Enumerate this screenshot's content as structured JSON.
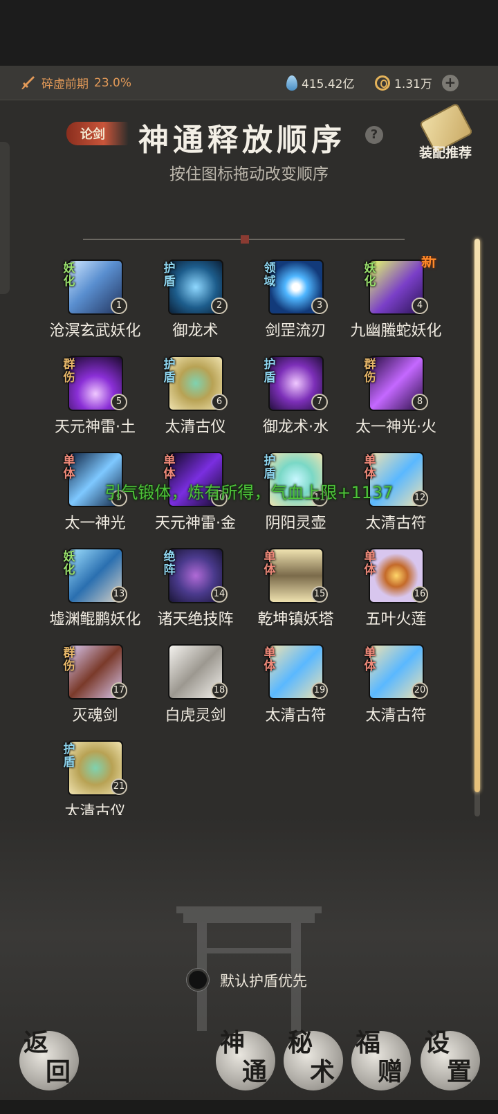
{
  "status": {
    "realm_label": "碎虚前期",
    "realm_percent": "23.0%",
    "spirit_stones": "415.42亿",
    "coins": "1.31万"
  },
  "header": {
    "badge": "论剑",
    "title": "神通释放顺序",
    "help": "?",
    "recommend": "装配推荐",
    "subtitle": "按住图标拖动改变顺序"
  },
  "skills": [
    {
      "num": "1",
      "name": "沧溟玄武妖化",
      "tag": "妖化",
      "tag_type": "yao",
      "art": "linear-gradient(135deg,#cfe6ff,#5a8fd0 45%,#22345e)"
    },
    {
      "num": "2",
      "name": "御龙术",
      "tag": "护盾",
      "tag_type": "shield",
      "art": "radial-gradient(circle,#8fd8ff,#1d5d8c 55%,#0c1f36)"
    },
    {
      "num": "3",
      "name": "剑罡流刃",
      "tag": "领域",
      "tag_type": "domain",
      "art": "radial-gradient(circle,#ffffff 10%,#4fb6ff 30%,#123a7a 70%)"
    },
    {
      "num": "4",
      "name": "九幽螣蛇妖化",
      "tag": "妖化",
      "tag_type": "yao",
      "art": "linear-gradient(135deg,#e6ff6a,#7a3fc8 55%,#2b1454)",
      "is_new": true,
      "new_label": "新"
    },
    {
      "num": "5",
      "name": "天元神雷·土",
      "tag": "群伤",
      "tag_type": "group",
      "art": "radial-gradient(circle at 50% 70%,#f0c8ff,#8a2fd6 40%,#1c0b2e)"
    },
    {
      "num": "6",
      "name": "太清古仪",
      "tag": "护盾",
      "tag_type": "shield",
      "art": "radial-gradient(circle,#7fd2b0,#b8a254 45%,#efe2b0)"
    },
    {
      "num": "7",
      "name": "御龙术·水",
      "tag": "护盾",
      "tag_type": "shield",
      "art": "radial-gradient(circle,#f0c8ff,#7c2fb8 50%,#24103e)"
    },
    {
      "num": "8",
      "name": "太一神光·火",
      "tag": "群伤",
      "tag_type": "group",
      "art": "linear-gradient(135deg,#2a0f44,#c468ff 50%,#2a0f44)"
    },
    {
      "num": "9",
      "name": "太一神光",
      "tag": "单体",
      "tag_type": "single",
      "art": "linear-gradient(135deg,#0f2240,#7ec8ff 50%,#0f2240)"
    },
    {
      "num": "10",
      "name": "天元神雷·金",
      "tag": "单体",
      "tag_type": "single",
      "art": "linear-gradient(135deg,#120a24,#7a2ee0 50%,#120a24)"
    },
    {
      "num": "11",
      "name": "阴阳灵壶",
      "tag": "护盾",
      "tag_type": "shield",
      "art": "radial-gradient(circle,#c8f7ff,#7ad8c6 45%,#efe2b0)"
    },
    {
      "num": "12",
      "name": "太清古符",
      "tag": "单体",
      "tag_type": "single",
      "art": "linear-gradient(135deg,#efe2b0,#5ab8ff 50%,#efe2b0)"
    },
    {
      "num": "13",
      "name": "墟渊鲲鹏妖化",
      "tag": "妖化",
      "tag_type": "yao",
      "art": "linear-gradient(135deg,#9fe0ff,#2a6fb0 50%,#d8d2c6)"
    },
    {
      "num": "14",
      "name": "诸天绝技阵",
      "tag": "绝阵",
      "tag_type": "formation",
      "art": "radial-gradient(circle,#b06ad6,#4a3a8c 50%,#1a1636)"
    },
    {
      "num": "15",
      "name": "乾坤镇妖塔",
      "tag": "单体",
      "tag_type": "single",
      "art": "linear-gradient(#efe2b0,#7a6a4a 50%,#efe2b0)"
    },
    {
      "num": "16",
      "name": "五叶火莲",
      "tag": "单体",
      "tag_type": "single",
      "art": "radial-gradient(circle,#ffd66a,#c46a2a 30%,#d8c6ee 60%)"
    },
    {
      "num": "17",
      "name": "灭魂剑",
      "tag": "群伤",
      "tag_type": "group",
      "art": "linear-gradient(135deg,#d8c6ee,#7a3a2a 50%,#d8c6ee)"
    },
    {
      "num": "18",
      "name": "白虎灵剑",
      "tag": "",
      "tag_type": "none",
      "art": "linear-gradient(135deg,#f4f2ee,#9c9890 50%,#f4f2ee)"
    },
    {
      "num": "19",
      "name": "太清古符",
      "tag": "单体",
      "tag_type": "single",
      "art": "linear-gradient(135deg,#efe2b0,#5ab8ff 50%,#efe2b0)"
    },
    {
      "num": "20",
      "name": "太清古符",
      "tag": "单体",
      "tag_type": "single",
      "art": "linear-gradient(135deg,#efe2b0,#5ab8ff 50%,#efe2b0)"
    },
    {
      "num": "21",
      "name": "太清古仪",
      "tag": "护盾",
      "tag_type": "shield",
      "art": "radial-gradient(circle,#7fd2b0,#b8a254 45%,#efe2b0)"
    }
  ],
  "toast": "引气锻体，炼有所得，气血上限+1137",
  "toggle_label": "默认护盾优先",
  "nav": {
    "back": [
      "返",
      "回"
    ],
    "skill": [
      "神",
      "通"
    ],
    "secret": [
      "秘",
      "术"
    ],
    "gift": [
      "福",
      "赠"
    ],
    "settings": [
      "设",
      "置"
    ]
  },
  "colors": {
    "background": "#2e2d2b",
    "realm_orange": "#e39a58",
    "toast_green": "#4ec43a"
  }
}
